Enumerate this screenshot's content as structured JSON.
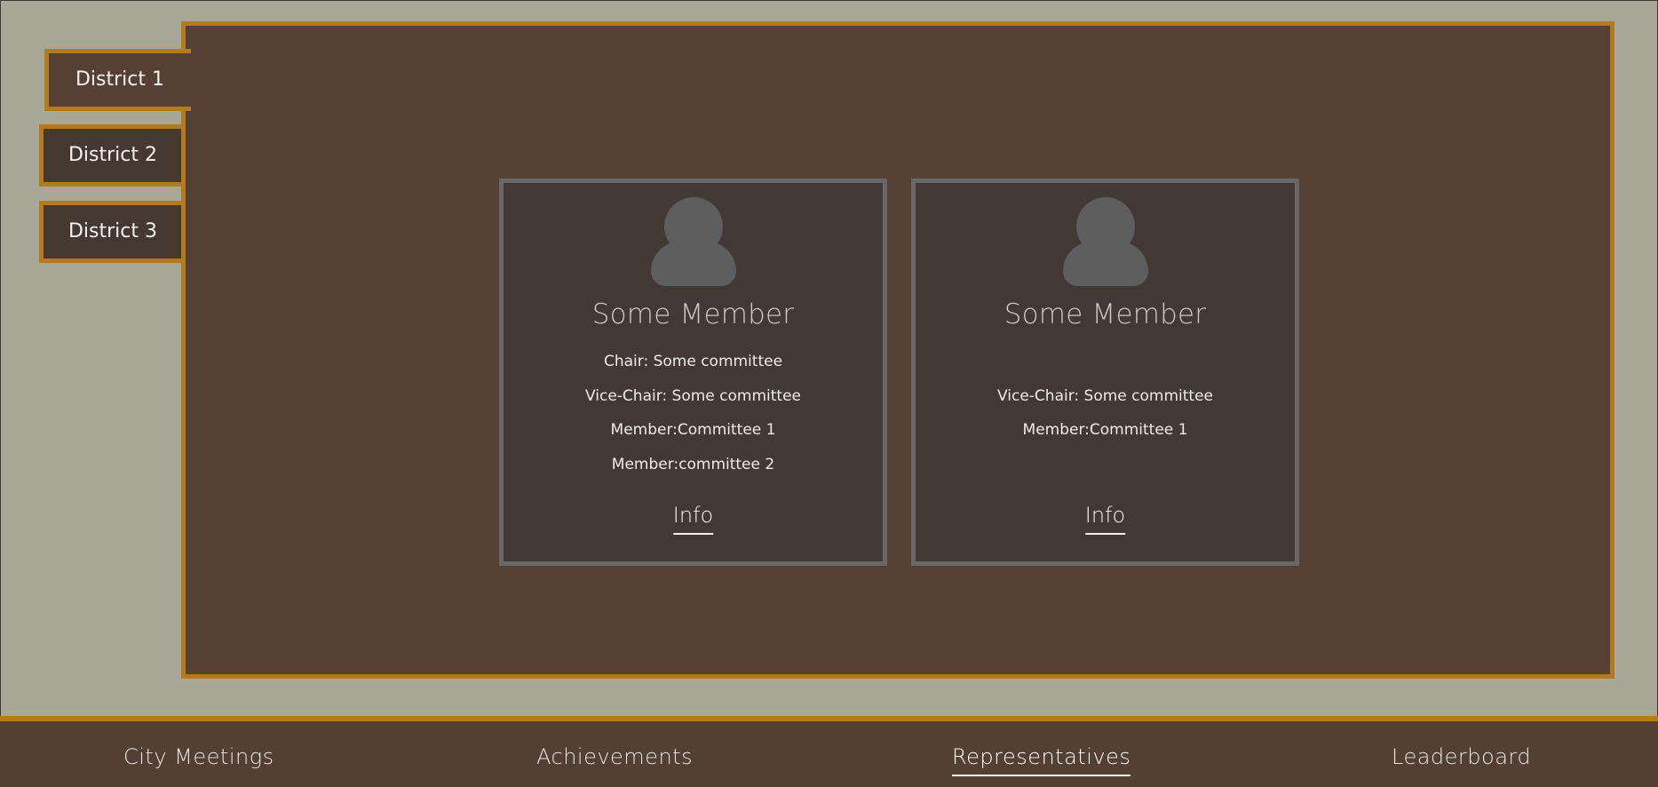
{
  "districts": [
    {
      "label": "District 1",
      "active": true
    },
    {
      "label": "District 2",
      "active": false
    },
    {
      "label": "District 3",
      "active": false
    }
  ],
  "members": [
    {
      "name": "Some Member",
      "chair": "Chair: Some committee",
      "vice_chair": "Vice-Chair: Some committee",
      "member1": "Member:Committee 1",
      "member2": "Member:committee 2",
      "info_label": "Info"
    },
    {
      "name": "Some Member",
      "chair": "",
      "vice_chair": "Vice-Chair: Some committee",
      "member1": "Member:Committee 1",
      "member2": "",
      "info_label": "Info"
    }
  ],
  "nav": {
    "items": [
      {
        "label": "City Meetings"
      },
      {
        "label": "Achievements"
      },
      {
        "label": "Representatives",
        "active": true
      },
      {
        "label": "Leaderboard"
      }
    ]
  },
  "colors": {
    "background": "#a7a897",
    "panel": "#563f33",
    "accent": "#b47a22",
    "card": "#433934"
  },
  "icons": {
    "avatar": "person-silhouette-icon"
  }
}
